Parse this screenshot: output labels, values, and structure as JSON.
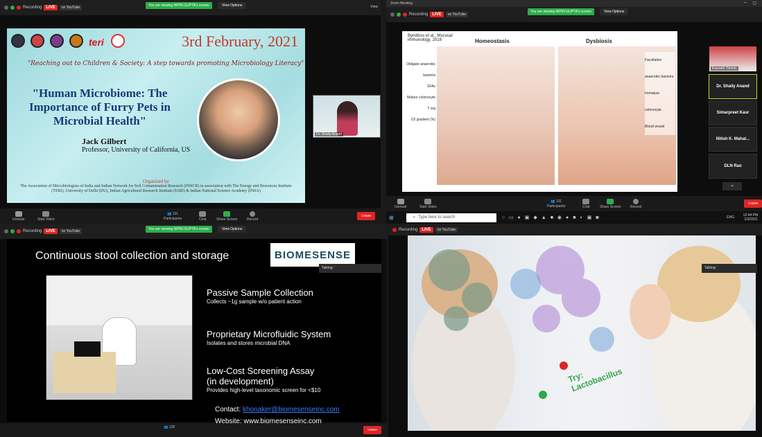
{
  "q1": {
    "recording": "Recording",
    "live": "LIVE",
    "on_youtube": "on YouTube",
    "viewing": "You are viewing NIPIN GUPTA's screen",
    "view_options": "View Options",
    "date": "3rd February, 2021",
    "tagline": "\"Reaching out to Children & Society: A step towards promoting Microbiology Literacy\"",
    "title": "\"Human Microbiome: The Importance of Furry Pets in Microbial Health\"",
    "speaker": "Jack Gilbert",
    "speaker_role": "Professor, University of California, US",
    "organized_by": "Organized by",
    "org_text": "The Association of Microbiologists of India and Indian Network for Soil Contamination Research (INSCR) in association with The Energy and Resources Institute (TERI), University of Delhi (DU), Indian Agricultural Research Institute (IARI) & Indian National Science Academy (INSA)",
    "cam_name": "Dr. Shaily Anand",
    "unmute": "Unmute",
    "start_video": "Start Video",
    "participants": "Participants",
    "participants_count": "131",
    "chat": "Chat",
    "share_screen": "Share Screen",
    "record": "Record",
    "leave": "Leave",
    "view": "View"
  },
  "q2": {
    "app_title": "Zoom Meeting",
    "recording": "Recording",
    "live": "LIVE",
    "on_youtube": "on YouTube",
    "viewing": "You are viewing NIPIN GUPTA's screen",
    "view_options": "View Options",
    "citation": "Byndloss et al., Mucosal Immunology, 2018",
    "homeostasis": "Homeostasis",
    "dysbiosis": "Dysbiosis",
    "labels_left": [
      "Obligate anaerobic bacteria",
      "SFAs",
      "Mature colonocyte",
      "T reg",
      "O2 gradient (%)"
    ],
    "labels_right": [
      "Facultative anaerobic bacteria",
      "Immature colonocyte",
      "Blood vessel"
    ],
    "participants": [
      "Dr. Shaily Anand",
      "Simarpreet Kaur",
      "Nitish K. Mahat...",
      "DLN Rao"
    ],
    "thumb_name": "Kasnath Timmis",
    "search_placeholder": "Type here to search",
    "time": "12:44 PM",
    "date": "2/3/2021",
    "lang": "ENG",
    "unmute": "Unmute",
    "start_video": "Start Video",
    "participants_label": "Participants",
    "participants_count": "131",
    "chat": "Chat",
    "share_screen": "Share Screen",
    "record": "Record",
    "leave": "Leave"
  },
  "q3": {
    "recording": "Recording",
    "live": "LIVE",
    "on_youtube": "on YouTube",
    "viewing": "You are viewing NIPIN GUPTA's screen",
    "view_options": "View Options",
    "heading": "Continuous stool collection and storage",
    "logo": "BIOMESENSE",
    "talking": "Talking:",
    "bullets": [
      {
        "h": "Passive Sample Collection",
        "s": "Collects ~1g sample w/o patient action"
      },
      {
        "h": "Proprietary Microfluidic System",
        "s": "Isolates and stores microbial DNA"
      },
      {
        "h": "Low-Cost Screening Assay",
        "h2": "(in development)",
        "s": "Provides high-level taxonomic screen for <$10"
      }
    ],
    "contact_label": "Contact:",
    "contact_email": "khonaker@biomesenseinc.com",
    "website": "Website: www.biomesenseinc.com",
    "participants_count": "128",
    "leave": "Leave"
  },
  "q4": {
    "recording": "Recording",
    "live": "LIVE",
    "on_youtube": "on YouTube",
    "talking": "Talking:",
    "try": "Try:",
    "lacto": "Lactobacillus"
  }
}
